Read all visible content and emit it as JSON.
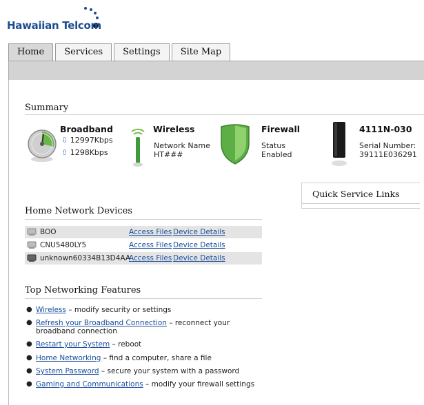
{
  "brand": {
    "name": "Hawaiian Telcom",
    "color": "#1d4d8f"
  },
  "tabs": [
    {
      "label": "Home",
      "active": true
    },
    {
      "label": "Services",
      "active": false
    },
    {
      "label": "Settings",
      "active": false
    },
    {
      "label": "Site Map",
      "active": false
    }
  ],
  "summary": {
    "title": "Summary",
    "broadband": {
      "title": "Broadband",
      "down": "12997Kbps",
      "up": "1298Kbps",
      "icon": "gauge-icon"
    },
    "wireless": {
      "title": "Wireless",
      "line1": "Network Name",
      "line2": "HT###",
      "icon": "antenna-icon"
    },
    "firewall": {
      "title": "Firewall",
      "line1": "Status",
      "line2": "Enabled",
      "icon": "shield-icon"
    },
    "device": {
      "title": "4111N-030",
      "line1": "Serial Number:",
      "line2": "39111E036291",
      "icon": "gateway-device-icon"
    }
  },
  "quick_links": {
    "title": "Quick Service Links"
  },
  "devices": {
    "title": "Home Network Devices",
    "access_label": "Access Files",
    "details_label": "Device Details",
    "rows": [
      {
        "name": "BOO"
      },
      {
        "name": "CNU5480LY5"
      },
      {
        "name": "unknown60334B13D4AA"
      }
    ]
  },
  "features": {
    "title": "Top Networking Features",
    "items": [
      {
        "link": "Wireless",
        "desc": " – modify security or settings",
        "desc2": ""
      },
      {
        "link": "Refresh your Broadband Connection",
        "desc": " – reconnect your",
        "desc2": "broadband connection"
      },
      {
        "link": "Restart your System",
        "desc": " – reboot",
        "desc2": ""
      },
      {
        "link": "Home Networking",
        "desc": " – find a computer, share a file",
        "desc2": ""
      },
      {
        "link": "System Password",
        "desc": " – secure your system with a password",
        "desc2": ""
      },
      {
        "link": "Gaming and Communications",
        "desc": " – modify your firewall settings",
        "desc2": ""
      }
    ]
  }
}
